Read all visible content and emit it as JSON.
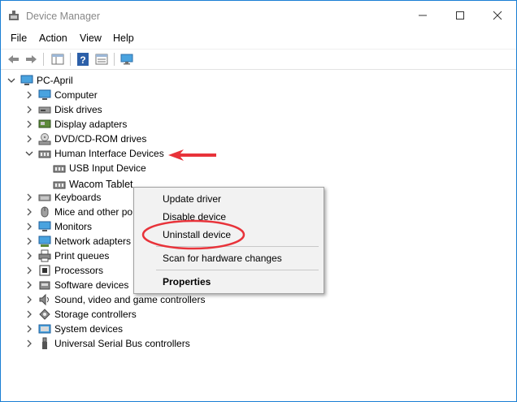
{
  "window": {
    "title": "Device Manager"
  },
  "menu": {
    "file": "File",
    "action": "Action",
    "view": "View",
    "help": "Help"
  },
  "tree": {
    "root": "PC-April",
    "categories": [
      "Computer",
      "Disk drives",
      "Display adapters",
      "DVD/CD-ROM drives",
      "Human Interface Devices",
      "Keyboards",
      "Mice and other po",
      "Monitors",
      "Network adapters",
      "Print queues",
      "Processors",
      "Software devices",
      "Sound, video and game controllers",
      "Storage controllers",
      "System devices",
      "Universal Serial Bus controllers"
    ],
    "hid_children": [
      "USB Input Device",
      "Wacom Tablet"
    ]
  },
  "context_menu": {
    "update": "Update driver",
    "disable": "Disable device",
    "uninstall": "Uninstall device",
    "scan": "Scan for hardware changes",
    "properties": "Properties"
  },
  "colors": {
    "accent": "#1a7fd4",
    "annotation": "#e8333a"
  }
}
